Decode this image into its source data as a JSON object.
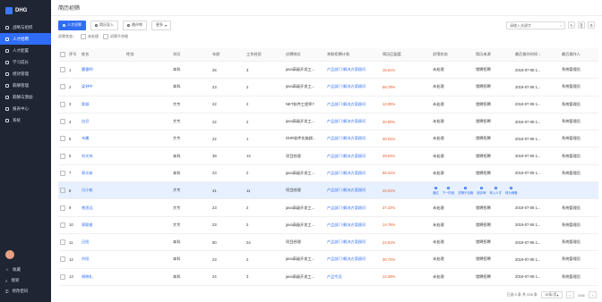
{
  "app": {
    "logo": "DHG"
  },
  "sidebar": {
    "items": [
      {
        "label": "战略与组织"
      },
      {
        "label": "人才招聘"
      },
      {
        "label": "人才配置"
      },
      {
        "label": "学习成长"
      },
      {
        "label": "绩效管理"
      },
      {
        "label": "薪酬管理"
      },
      {
        "label": "薪酬与激励"
      },
      {
        "label": "报表中心"
      },
      {
        "label": "系统"
      }
    ],
    "bottom": [
      {
        "label": "收藏"
      },
      {
        "label": "搜索"
      },
      {
        "label": "修改密码"
      }
    ]
  },
  "header": {
    "title": "简历初筛"
  },
  "toolbar": {
    "buttons": [
      {
        "label": "人才初筛"
      },
      {
        "label": "简历导入"
      },
      {
        "label": "邀评审"
      },
      {
        "label": "更多"
      }
    ],
    "search_placeholder": "请输入关键字",
    "search_icon": "search-icon",
    "refresh": "↻",
    "export": "⎘",
    "settings": "⚙"
  },
  "filters": {
    "label": "初筛状态：",
    "opt1": "未处理",
    "opt2": "初筛不合格"
  },
  "table": {
    "columns": [
      "序号",
      "姓名",
      "性别",
      "学历",
      "年龄",
      "工作经验",
      "应聘岗位",
      "关联招聘计划",
      "简历匹配度",
      "初筛状态",
      "简历来源",
      "最后操作时间 ↓",
      "最后操作人"
    ],
    "rows": [
      [
        "1",
        "曹雷明",
        "",
        "本科",
        "25",
        "3",
        "java高级开发工...",
        "产品部门-解决方案顾问",
        "15.61%",
        "未处理",
        "猎聘招聘",
        "2019-07-08 1...",
        "系统管理员"
      ],
      [
        "2",
        "梁钟中",
        "",
        "本科",
        "23",
        "2",
        "java高级开发工...",
        "产品部门-解决方案顾问",
        "58.79%",
        "未处理",
        "猎聘招聘",
        "2019-07-08 1...",
        "系统管理员"
      ],
      [
        "3",
        "陈颖",
        "",
        "大专",
        "22",
        "2",
        "NET软件工程师7",
        "产品部门-解决方案顾问",
        "13.05%",
        "未处理",
        "猎聘招聘",
        "2019-07-08 1...",
        "系统管理员"
      ],
      [
        "4",
        "白召",
        "",
        "大专",
        "22",
        "2",
        "java高级开发工...",
        "产品部门-解决方案顾问",
        "40.00%",
        "未处理",
        "猎聘招聘",
        "2019-07-08 1...",
        "系统管理员"
      ],
      [
        "5",
        "韦雕",
        "",
        "大专",
        "22",
        "1",
        "DHR软件实施顾...",
        "产品部门-解决方案顾问",
        "40.01%",
        "未处理",
        "猎聘招聘",
        "2019-07-08 1...",
        "系统管理员"
      ],
      [
        "6",
        "刘光伟",
        "",
        "本科",
        "38",
        "14",
        "项目经理",
        "产品部门-解决方案顾问",
        "29.04%",
        "未处理",
        "猎聘招聘",
        "2019-07-08 1...",
        "系统管理员"
      ],
      [
        "7",
        "郭光彬",
        "",
        "本科",
        "23",
        "2",
        "java高级开发工...",
        "产品部门-解决方案顾问",
        "55.31%",
        "未处理",
        "猎聘招聘",
        "2019-07-08 1...",
        "系统管理员"
      ],
      [
        "8",
        "冯小彬",
        "",
        "大专",
        "41",
        "11",
        "项目经理",
        "产品部门-解决方案顾问",
        "44.01%",
        "",
        "",
        "",
        ""
      ],
      [
        "9",
        "曾思远",
        "",
        "大专",
        "23",
        "2",
        "java高级开发工...",
        "产品部门-解决方案顾问",
        "37.22%",
        "未处理",
        "猎聘招聘",
        "2019-07-08 1...",
        "系统管理员"
      ],
      [
        "10",
        "郭聪俊",
        "",
        "大专",
        "23",
        "2",
        "java高级开发工...",
        "产品部门-解决方案顾问",
        "14.76%",
        "未处理",
        "猎聘招聘",
        "2019-07-08 1...",
        "系统管理员"
      ],
      [
        "11",
        "吕阳",
        "",
        "本科",
        "50",
        "24",
        "项目经理",
        "产品部门-解决方案顾问",
        "24.01%",
        "未处理",
        "猎聘招聘",
        "2019-07-08 1...",
        "系统管理员"
      ],
      [
        "12",
        "刘阳",
        "",
        "本科",
        "23",
        "2",
        "java高级开发工...",
        "产品部门-解决方案顾问",
        "30.72%",
        "未处理",
        "猎聘招聘",
        "2019-07-08 1...",
        "系统管理员"
      ],
      [
        "13",
        "胡晓礼",
        "",
        "本科",
        "24",
        "3",
        "java高级开发工...",
        "产品专员",
        "14.29%",
        "未处理",
        "猎聘招聘",
        "2019-07-08 1...",
        "系统管理员"
      ]
    ],
    "row_actions": [
      "通过",
      "下一阶段",
      "初筛不合格",
      "邀评审",
      "转入人才",
      "转为储备"
    ]
  },
  "pagination": {
    "summary": "已选 0 条   共 226 条",
    "page_size": "15条/页",
    "prev": "‹",
    "page": "1/16",
    "next": "›"
  }
}
